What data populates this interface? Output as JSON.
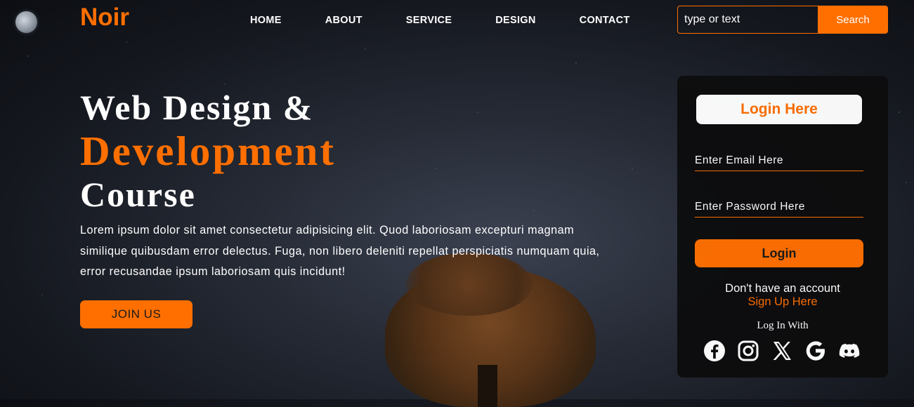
{
  "brand": {
    "name": "Noir",
    "accent": "#ff6f00"
  },
  "nav": {
    "items": [
      {
        "label": "HOME"
      },
      {
        "label": "ABOUT"
      },
      {
        "label": "SERVICE"
      },
      {
        "label": "DESIGN"
      },
      {
        "label": "CONTACT"
      }
    ]
  },
  "search": {
    "placeholder": "type or text",
    "button_label": "Search"
  },
  "hero": {
    "title_line1": "Web Design &",
    "title_line2": "Development",
    "title_line3": "Course",
    "text": "Lorem ipsum dolor sit amet consectetur adipisicing elit. Quod laboriosam excepturi magnam similique quibusdam error delectus. Fuga, non libero deleniti repellat perspiciatis numquam quia, error recusandae ipsum laboriosam quis incidunt!",
    "join_label": "JOIN US"
  },
  "login": {
    "title": "Login Here",
    "email_placeholder": "Enter Email Here",
    "password_placeholder": "Enter Password Here",
    "button_label": "Login",
    "no_account_text": "Don't have an account",
    "signup_label": "Sign Up Here",
    "login_with_label": "Log In With",
    "social_icons": [
      "facebook-icon",
      "instagram-icon",
      "x-icon",
      "google-icon",
      "discord-icon"
    ]
  }
}
